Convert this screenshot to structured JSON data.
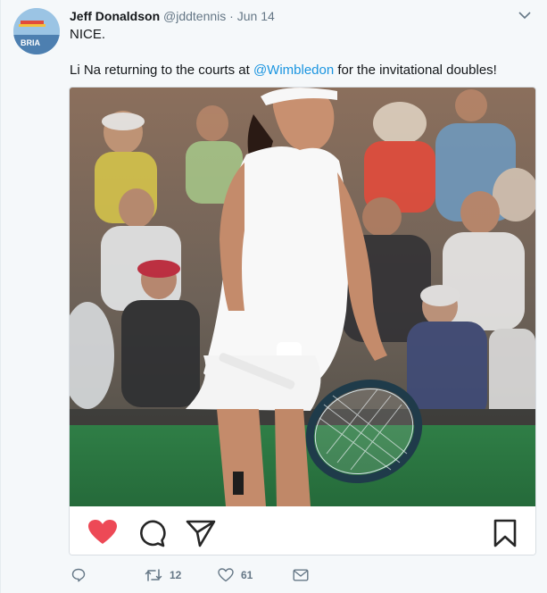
{
  "tweet": {
    "author_name": "Jeff Donaldson",
    "author_handle": "@jddtennis",
    "separator": "·",
    "date": "Jun 14",
    "avatar_text": "BRIA",
    "text_line1": "NICE.",
    "text_line2_pre": "Li Na returning to the courts at ",
    "text_line2_mention": "@Wimbledon",
    "text_line2_post": " for the invitational doubles!",
    "retweet_count": "12",
    "like_count": "61"
  },
  "embed": {
    "liked": true,
    "icons": [
      "heart-icon",
      "comment-bubble-icon",
      "share-paper-plane-icon",
      "bookmark-icon"
    ]
  },
  "colors": {
    "link": "#1b95e0",
    "secondary_text": "#657786",
    "heart": "#ed4956",
    "grass": "#2d7a43"
  }
}
